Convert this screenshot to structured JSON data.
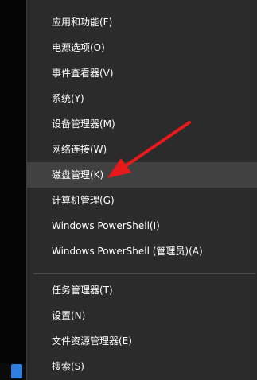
{
  "menu": {
    "group1": [
      {
        "label": "应用和功能(F)"
      },
      {
        "label": "电源选项(O)"
      },
      {
        "label": "事件查看器(V)"
      },
      {
        "label": "系统(Y)"
      },
      {
        "label": "设备管理器(M)"
      },
      {
        "label": "网络连接(W)"
      },
      {
        "label": "磁盘管理(K)",
        "highlighted": true
      },
      {
        "label": "计算机管理(G)"
      },
      {
        "label": "Windows PowerShell(I)"
      },
      {
        "label": "Windows PowerShell (管理员)(A)"
      }
    ],
    "group2": [
      {
        "label": "任务管理器(T)"
      },
      {
        "label": "设置(N)"
      },
      {
        "label": "文件资源管理器(E)"
      },
      {
        "label": "搜索(S)"
      }
    ]
  },
  "colors": {
    "menu_background": "#2b2b2b",
    "highlight": "#414141",
    "text": "#ffffff",
    "annotation_arrow": "#e8191b",
    "taskbar_icon": "#2f7fe0"
  },
  "annotation": {
    "icon": "red-arrow-icon"
  }
}
